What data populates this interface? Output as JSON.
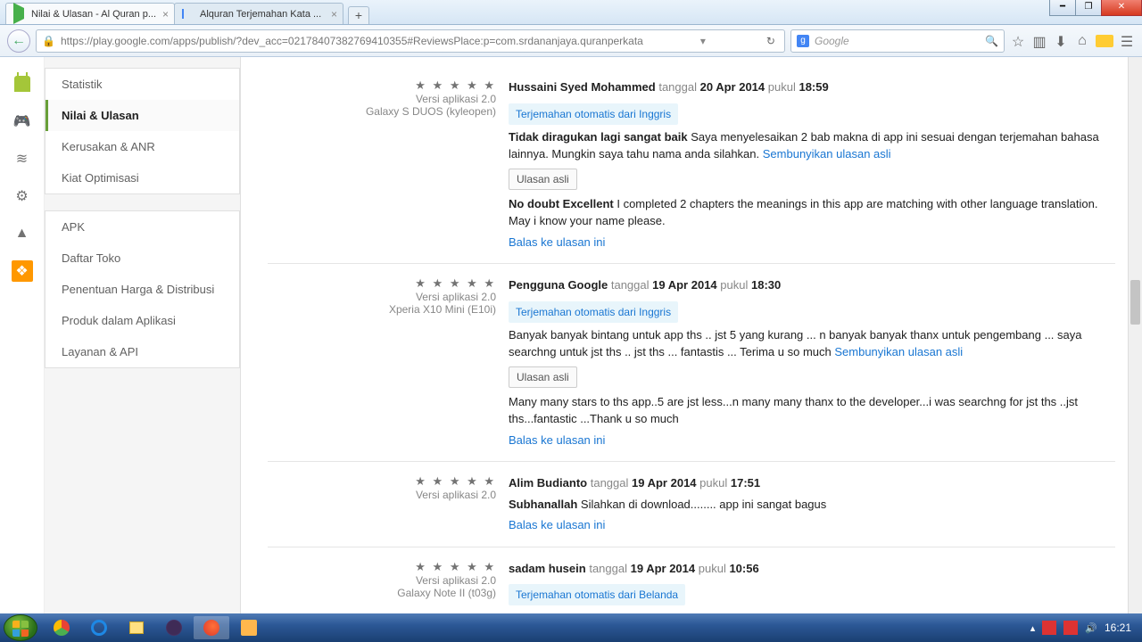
{
  "window": {
    "tabs": [
      {
        "title": "Nilai & Ulasan - Al Quran p..."
      },
      {
        "title": "Alquran Terjemahan Kata ..."
      }
    ],
    "url": "https://play.google.com/apps/publish/?dev_acc=02178407382769410355#ReviewsPlace:p=com.srdananjaya.quranperkata",
    "search_placeholder": "Google"
  },
  "sidebar": {
    "g1": [
      "Statistik",
      "Nilai & Ulasan",
      "Kerusakan & ANR",
      "Kiat Optimisasi"
    ],
    "g2": [
      "APK",
      "Daftar Toko",
      "Penentuan Harga & Distribusi",
      "Produk dalam Aplikasi",
      "Layanan & API"
    ],
    "active": "Nilai & Ulasan"
  },
  "labels": {
    "version_prefix": "Versi aplikasi",
    "tanggal": "tanggal",
    "pukul": "pukul",
    "translated_from_en": "Terjemahan otomatis dari Inggris",
    "translated_from_nl": "Terjemahan otomatis dari Belanda",
    "hide_original": "Sembunyikan ulasan asli",
    "original_label": "Ulasan asli",
    "reply": "Balas ke ulasan ini",
    "stars5": "★ ★ ★ ★ ★"
  },
  "reviews": [
    {
      "version": "2.0",
      "device": "Galaxy S DUOS (kyleopen)",
      "author": "Hussaini Syed Mohammed",
      "date": "20 Apr 2014",
      "time": "18:59",
      "translated_from": "en",
      "title": "Tidak diragukan lagi sangat baik",
      "text": "Saya menyelesaikan 2 bab makna di app ini sesuai dengan terjemahan bahasa lainnya. Mungkin saya tahu nama anda silahkan.",
      "orig_title": "No doubt Excellent",
      "orig_text": "I completed 2 chapters the meanings in this app are matching with other language translation. May i know your name please."
    },
    {
      "version": "2.0",
      "device": "Xperia X10 Mini (E10i)",
      "author": "Pengguna Google",
      "date": "19 Apr 2014",
      "time": "18:30",
      "translated_from": "en",
      "title": "",
      "text": "Banyak banyak bintang untuk app ths .. jst 5 yang kurang ... n banyak banyak thanx untuk pengembang ... saya searchng untuk jst ths .. jst ths ... fantastis ... Terima u so much",
      "orig_title": "",
      "orig_text": "Many many stars to ths app..5 are jst less...n many many thanx to the developer...i was searchng for jst ths ..jst ths...fantastic ...Thank u so much"
    },
    {
      "version": "2.0",
      "device": "",
      "author": "Alim Budianto",
      "date": "19 Apr 2014",
      "time": "17:51",
      "translated_from": "",
      "title": "Subhanallah",
      "text": "Silahkan di download........ app ini sangat bagus",
      "orig_title": "",
      "orig_text": ""
    },
    {
      "version": "2.0",
      "device": "Galaxy Note II (t03g)",
      "author": "sadam husein",
      "date": "19 Apr 2014",
      "time": "10:56",
      "translated_from": "nl",
      "title": "",
      "text": "",
      "orig_title": "",
      "orig_text": ""
    }
  ],
  "tray": {
    "time": "16:21"
  }
}
